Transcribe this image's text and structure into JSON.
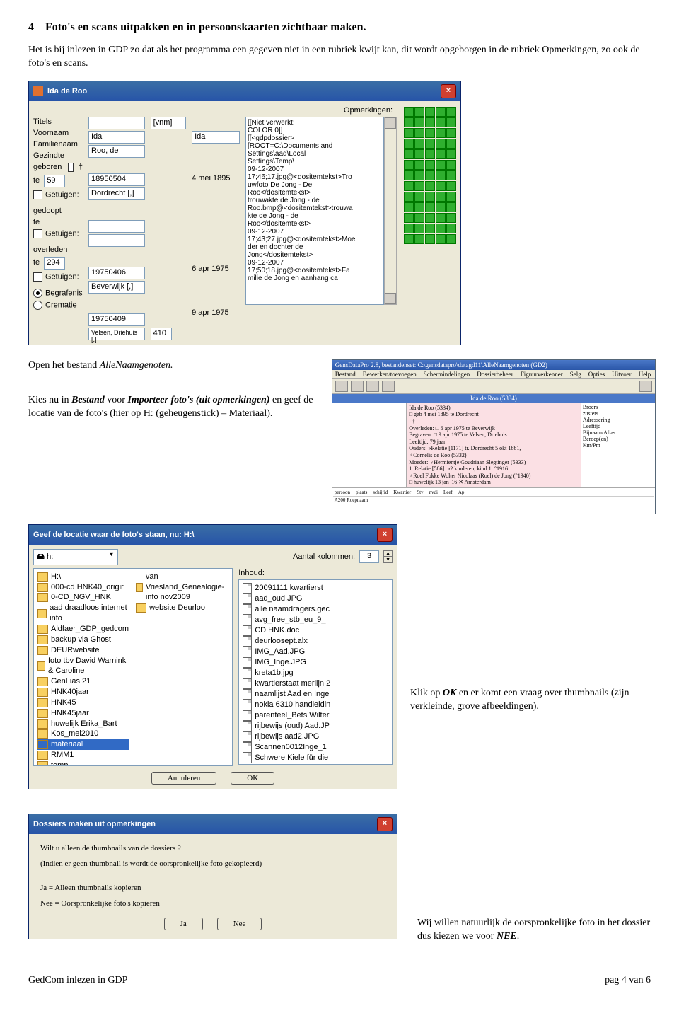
{
  "section": {
    "number": "4",
    "title": "Foto's en scans uitpakken en in persoonskaarten zichtbaar maken."
  },
  "intro": "Het is bij inlezen in GDP zo dat als het programma een gegeven niet in een rubriek kwijt kan, dit wordt opgeborgen in de rubriek Opmerkingen, zo ook de foto's en scans.",
  "personWindow": {
    "title": "Ida de Roo",
    "labels": {
      "titels": "Titels",
      "voornaam": "Voornaam",
      "familienaam": "Familienaam",
      "gezindte": "Gezindte",
      "geboren": "geboren",
      "te": "te",
      "getuigen": "Getuigen:",
      "gedoopt": "gedoopt",
      "overleden": "overleden",
      "begrafenis": "Begrafenis",
      "crematie": "Crematie",
      "opmerkingen": "Opmerkingen:",
      "vnm": "[vnm]"
    },
    "values": {
      "voornaam": "Ida",
      "roepnaam": "Ida",
      "familienaam": "Roo, de",
      "geb_datum": "18950504",
      "geb_display": "4 mei 1895",
      "geb_code": "59",
      "geb_plaats": "Dordrecht [,]",
      "ovl_datum": "19750406",
      "ovl_display": "6 apr 1975",
      "ovl_code": "294",
      "ovl_plaats": "Beverwijk [,]",
      "beg_datum": "19750409",
      "beg_display": "9 apr 1975",
      "beg_code": "410",
      "beg_plaats": "Velsen, Driehuis [,]"
    },
    "opm": "[[Niet verwerkt:\nCOLOR 0]]\n[[<gdpdossier>\n[ROOT=C:\\Documents and\nSettings\\aad\\Local\nSettings\\Temp\\\n09-12-2007\n17;46;17.jpg@<dositemtekst>Tro\nuwfoto De Jong - De\nRoo</dositemtekst>\ntrouwakte de Jong - de\nRoo.bmp@<dositemtekst>trouwa\nkte de Jong - de\nRoo</dositemtekst>\n09-12-2007\n17;43;27.jpg@<dositemtekst>Moe\nder en dochter de\nJong</dositemtekst>\n09-12-2007\n17;50;18.jpg@<dositemtekst>Fa\nmilie de Jong en aanhang ca"
  },
  "tc": {
    "leftA": "Open het bestand ",
    "leftA2": "AlleNaamgenoten.",
    "leftB1": "Kies nu in ",
    "leftB2": "Bestand",
    "leftB3": " voor ",
    "leftB4": "Importeer foto's (uit opmerkingen)",
    "leftB5": " en geef de locatie van de foto's (hier op H: (geheugenstick) – Materiaal).",
    "mini": {
      "tb": "GensDataPro 2.8, bestandenset: C:\\gensdatapro\\datagd11\\AlleNaamgenoten (GD2)",
      "menus": [
        "Bestand",
        "Bewerken/toevoegen",
        "Schermindelingen",
        "Dossierbeheer",
        "Figuurverkenner",
        "Selg",
        "Opties",
        "Uitvoer",
        "Help"
      ],
      "headName": "Ida de Roo (5334)",
      "pm": [
        "Ida de Roo (5334)",
        "□ geb 4 mei 1895 te Dordrecht",
        "· †",
        "Overleden:    □ 6 apr 1975 te Beverwijk",
        "Begraven:     □ 9 apr 1975 te Velsen, Driehuis",
        "Leeftijd:       79 jaar",
        "Ouders:        »Relatie [1171] tr. Dordrecht 5 okt 1881,",
        "               ♂Cornelis de Roo (5332)",
        "Moeder:       ♀Hermientje Goudriaan Slegtinger (5333)",
        "1. Relatie [586]:  »2 kinderen, kind 1: °1916",
        "               ♂Roel Fokke Wolter Nicolaas (Roel) de Jong (°1940)",
        "               □ huwelijk 13 jan '16   ✕ Amsterdam"
      ],
      "pr": [
        "Broers",
        "zusters",
        "Adressering",
        "Leeftijd",
        "Bijnaam/Alias",
        "Beroep(en)",
        "Km/Pm"
      ],
      "btmLabels": [
        "persoon",
        "plaats",
        "schijfid",
        "Kwartier",
        "Stv",
        "nvdi",
        "Leef",
        "Ap"
      ],
      "btmRow": "A200 Roepnaam"
    }
  },
  "fileDialog": {
    "title": "Geef de locatie waar de foto's staan, nu: H:\\",
    "driveLabel": "h:",
    "aantal": "Aantal kolommen:",
    "aantalVal": "3",
    "inhoud": "Inhoud:",
    "left": [
      "H:\\",
      "000-cd HNK40_origir",
      "0-CD_NGV_HNK",
      "aad draadloos internet info",
      "Aldfaer_GDP_gedcom",
      "backup via Ghost",
      "DEURwebsite",
      "foto tbv David Warnink & Caroline",
      "GenLias 21",
      "HNK40jaar",
      "HNK45",
      "HNK45jaar",
      "huwelijk Erika_Bart",
      "Kos_mei2010",
      "materiaal",
      "RMM1",
      "temp"
    ],
    "leftCol2": [
      "van Vriesland_Genealogie-info nov2009",
      "website Deurloo"
    ],
    "right": [
      "20091111 kwartierst",
      "aad_oud.JPG",
      "alle naamdragers.gec",
      "avg_free_stb_eu_9_",
      "CD HNK.doc",
      "deurloosept.alx",
      "IMG_Aad.JPG",
      "IMG_Inge.JPG",
      "kreta1b.jpg",
      "kwartierstaat merlijn 2",
      "naamlijst Aad en Inge",
      "nokia 6310 handleidin",
      "parenteel_Bets Wilter",
      "rijbewijs (oud) Aad.JP",
      "rijbewijs aad2.JPG",
      "Scannen0012Inge_1",
      "Schwere Kiele für die"
    ],
    "btnCancel": "Annuleren",
    "btnOk": "OK",
    "rightText": "Klik op OK en er komt een vraag over thumbnails (zijn verkleinde, grove afbeeldingen)."
  },
  "thumbDlg": {
    "title": "Dossiers maken uit opmerkingen",
    "p1": "Wilt u alleen de thumbnails van de dossiers ?",
    "p2": "(Indien er geen thumbnail is wordt de oorspronkelijke foto gekopieerd)",
    "p3": "Ja = Alleen thumbnails kopieren",
    "p4": "Nee = Oorspronkelijke foto's kopieren",
    "btnJa": "Ja",
    "btnNee": "Nee",
    "sideText": "Wij willen natuurlijk de oorspronkelijke foto in het dossier dus kiezen we voor NEE."
  },
  "footer": {
    "left": "GedCom inlezen in GDP",
    "right": "pag 4 van 6"
  }
}
